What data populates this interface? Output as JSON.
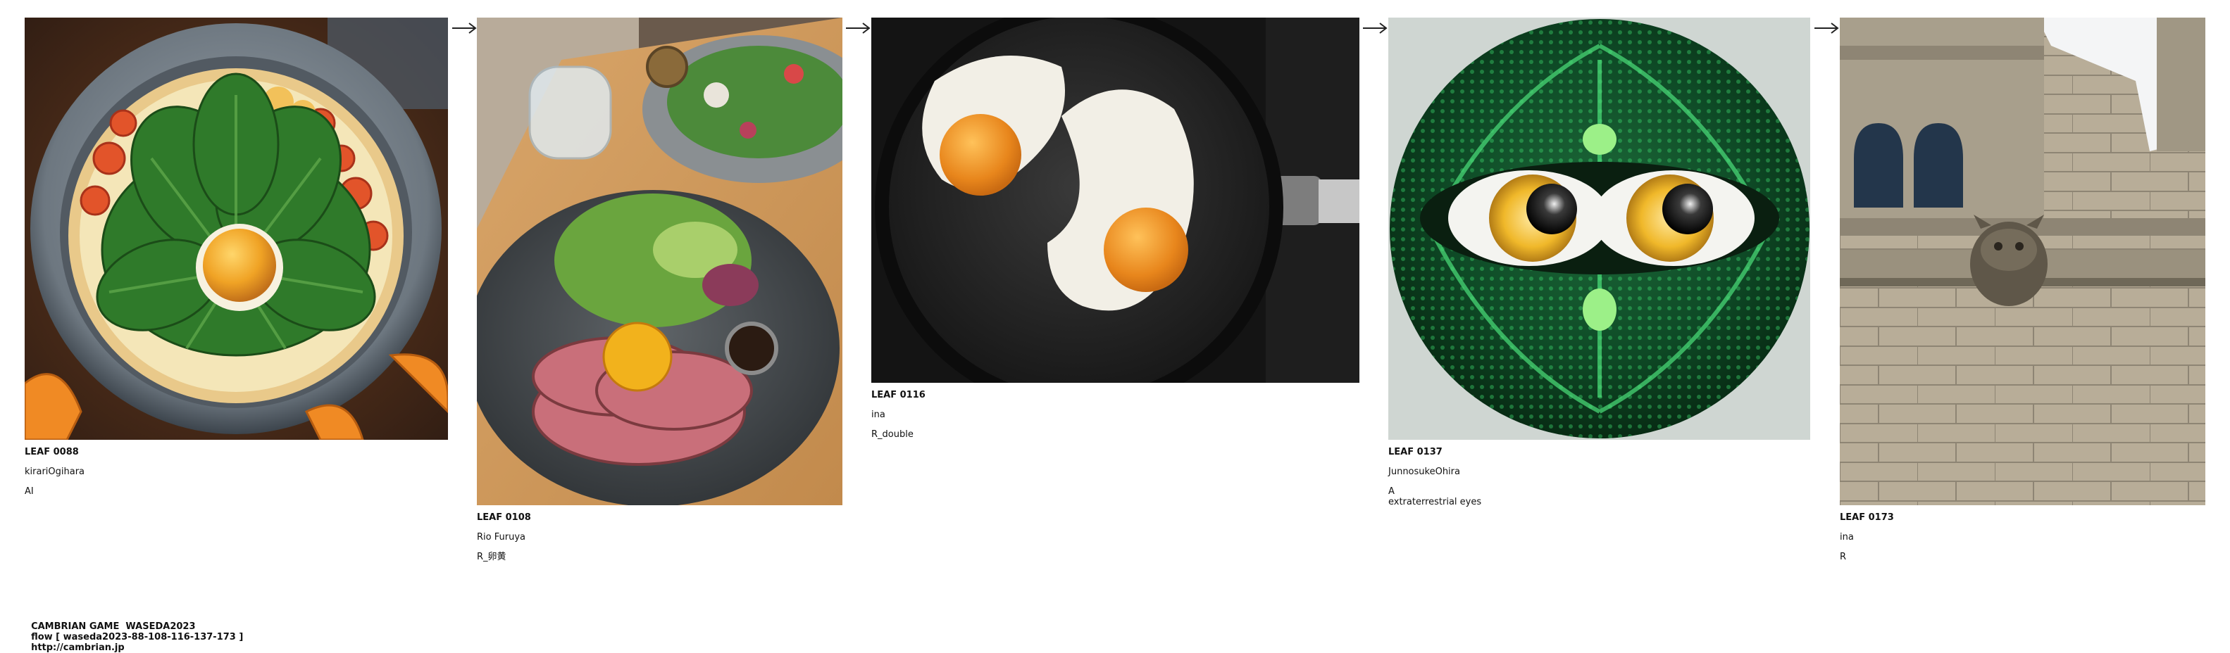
{
  "leaves": [
    {
      "id": "LEAF 0088",
      "author": "kirariOgihara",
      "title": "AI",
      "image_subject": "pizza with kale and sunny-side egg"
    },
    {
      "id": "LEAF 0108",
      "author": "Rio Furuya",
      "title": "R_卵黄",
      "image_subject": "roast beef bowl with egg yolk and salad"
    },
    {
      "id": "LEAF 0116",
      "author": "ina",
      "title": "R_double",
      "image_subject": "two fried eggs in a black frying pan"
    },
    {
      "id": "LEAF 0137",
      "author": "JunnosukeOhira",
      "title": "A\nextraterrestrial eyes",
      "image_subject": "green reptilian alien face with two eyes"
    },
    {
      "id": "LEAF 0173",
      "author": "ina",
      "title": "R",
      "image_subject": "stone building with gargoyle"
    }
  ],
  "arrow_glyph": "→",
  "footer": {
    "game": "CAMBRIAN GAME  WASEDA2023",
    "flow": "flow [ waseda2023-88-108-116-137-173 ]",
    "url": "http://cambrian.jp"
  },
  "colors": {
    "text": "#111111",
    "background": "#ffffff",
    "arrow": "#222222"
  }
}
